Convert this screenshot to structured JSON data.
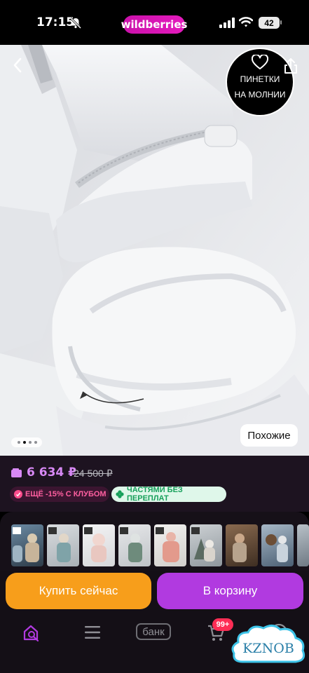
{
  "status_bar": {
    "time": "17:15",
    "brand": "wildberries",
    "battery": "42"
  },
  "product_image": {
    "badge_lines": [
      "ПИНЕТКИ",
      "НА МОЛНИИ"
    ],
    "similar_label": "Похожие",
    "pager_total": 4,
    "pager_active": 1
  },
  "pricing": {
    "price": "6 634 ₽",
    "old_price": "24 500 ₽",
    "club_tag": "ЕЩЁ -15% С КЛУБОМ",
    "installment_tag": "ЧАСТЯМИ БЕЗ ПЕРЕПЛАТ"
  },
  "actions": {
    "buy_now": "Купить сейчас",
    "add_to_cart": "В корзину"
  },
  "bottom_nav": {
    "items": [
      "home-search-icon",
      "catalog-menu-icon",
      "bank-tab",
      "cart-icon",
      "profile-icon"
    ],
    "bank_label": "банк",
    "cart_badge": "99+"
  },
  "watermark": "KZNOB",
  "colors": {
    "brand_gradient": [
      "#cb11ab",
      "#e41bbd"
    ],
    "price": "#d889f5",
    "buy_button": "#f79e1b",
    "cart_button": "#b13ae0",
    "badge_red": "#ff2d55"
  }
}
